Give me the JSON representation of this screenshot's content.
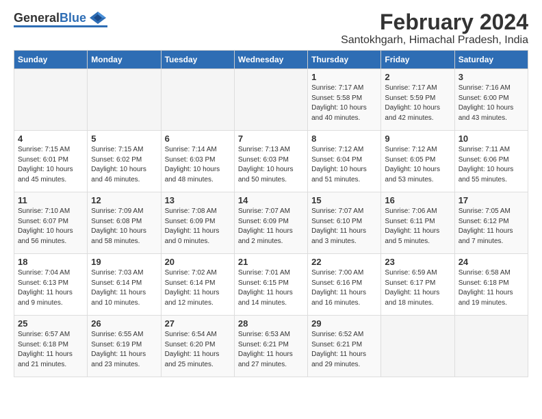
{
  "header": {
    "logo_general": "General",
    "logo_blue": "Blue",
    "title": "February 2024",
    "subtitle": "Santokhgarh, Himachal Pradesh, India"
  },
  "columns": [
    "Sunday",
    "Monday",
    "Tuesday",
    "Wednesday",
    "Thursday",
    "Friday",
    "Saturday"
  ],
  "weeks": [
    [
      {
        "day": "",
        "sunrise": "",
        "sunset": "",
        "daylight": ""
      },
      {
        "day": "",
        "sunrise": "",
        "sunset": "",
        "daylight": ""
      },
      {
        "day": "",
        "sunrise": "",
        "sunset": "",
        "daylight": ""
      },
      {
        "day": "",
        "sunrise": "",
        "sunset": "",
        "daylight": ""
      },
      {
        "day": "1",
        "sunrise": "Sunrise: 7:17 AM",
        "sunset": "Sunset: 5:58 PM",
        "daylight": "Daylight: 10 hours and 40 minutes."
      },
      {
        "day": "2",
        "sunrise": "Sunrise: 7:17 AM",
        "sunset": "Sunset: 5:59 PM",
        "daylight": "Daylight: 10 hours and 42 minutes."
      },
      {
        "day": "3",
        "sunrise": "Sunrise: 7:16 AM",
        "sunset": "Sunset: 6:00 PM",
        "daylight": "Daylight: 10 hours and 43 minutes."
      }
    ],
    [
      {
        "day": "4",
        "sunrise": "Sunrise: 7:15 AM",
        "sunset": "Sunset: 6:01 PM",
        "daylight": "Daylight: 10 hours and 45 minutes."
      },
      {
        "day": "5",
        "sunrise": "Sunrise: 7:15 AM",
        "sunset": "Sunset: 6:02 PM",
        "daylight": "Daylight: 10 hours and 46 minutes."
      },
      {
        "day": "6",
        "sunrise": "Sunrise: 7:14 AM",
        "sunset": "Sunset: 6:03 PM",
        "daylight": "Daylight: 10 hours and 48 minutes."
      },
      {
        "day": "7",
        "sunrise": "Sunrise: 7:13 AM",
        "sunset": "Sunset: 6:03 PM",
        "daylight": "Daylight: 10 hours and 50 minutes."
      },
      {
        "day": "8",
        "sunrise": "Sunrise: 7:12 AM",
        "sunset": "Sunset: 6:04 PM",
        "daylight": "Daylight: 10 hours and 51 minutes."
      },
      {
        "day": "9",
        "sunrise": "Sunrise: 7:12 AM",
        "sunset": "Sunset: 6:05 PM",
        "daylight": "Daylight: 10 hours and 53 minutes."
      },
      {
        "day": "10",
        "sunrise": "Sunrise: 7:11 AM",
        "sunset": "Sunset: 6:06 PM",
        "daylight": "Daylight: 10 hours and 55 minutes."
      }
    ],
    [
      {
        "day": "11",
        "sunrise": "Sunrise: 7:10 AM",
        "sunset": "Sunset: 6:07 PM",
        "daylight": "Daylight: 10 hours and 56 minutes."
      },
      {
        "day": "12",
        "sunrise": "Sunrise: 7:09 AM",
        "sunset": "Sunset: 6:08 PM",
        "daylight": "Daylight: 10 hours and 58 minutes."
      },
      {
        "day": "13",
        "sunrise": "Sunrise: 7:08 AM",
        "sunset": "Sunset: 6:09 PM",
        "daylight": "Daylight: 11 hours and 0 minutes."
      },
      {
        "day": "14",
        "sunrise": "Sunrise: 7:07 AM",
        "sunset": "Sunset: 6:09 PM",
        "daylight": "Daylight: 11 hours and 2 minutes."
      },
      {
        "day": "15",
        "sunrise": "Sunrise: 7:07 AM",
        "sunset": "Sunset: 6:10 PM",
        "daylight": "Daylight: 11 hours and 3 minutes."
      },
      {
        "day": "16",
        "sunrise": "Sunrise: 7:06 AM",
        "sunset": "Sunset: 6:11 PM",
        "daylight": "Daylight: 11 hours and 5 minutes."
      },
      {
        "day": "17",
        "sunrise": "Sunrise: 7:05 AM",
        "sunset": "Sunset: 6:12 PM",
        "daylight": "Daylight: 11 hours and 7 minutes."
      }
    ],
    [
      {
        "day": "18",
        "sunrise": "Sunrise: 7:04 AM",
        "sunset": "Sunset: 6:13 PM",
        "daylight": "Daylight: 11 hours and 9 minutes."
      },
      {
        "day": "19",
        "sunrise": "Sunrise: 7:03 AM",
        "sunset": "Sunset: 6:14 PM",
        "daylight": "Daylight: 11 hours and 10 minutes."
      },
      {
        "day": "20",
        "sunrise": "Sunrise: 7:02 AM",
        "sunset": "Sunset: 6:14 PM",
        "daylight": "Daylight: 11 hours and 12 minutes."
      },
      {
        "day": "21",
        "sunrise": "Sunrise: 7:01 AM",
        "sunset": "Sunset: 6:15 PM",
        "daylight": "Daylight: 11 hours and 14 minutes."
      },
      {
        "day": "22",
        "sunrise": "Sunrise: 7:00 AM",
        "sunset": "Sunset: 6:16 PM",
        "daylight": "Daylight: 11 hours and 16 minutes."
      },
      {
        "day": "23",
        "sunrise": "Sunrise: 6:59 AM",
        "sunset": "Sunset: 6:17 PM",
        "daylight": "Daylight: 11 hours and 18 minutes."
      },
      {
        "day": "24",
        "sunrise": "Sunrise: 6:58 AM",
        "sunset": "Sunset: 6:18 PM",
        "daylight": "Daylight: 11 hours and 19 minutes."
      }
    ],
    [
      {
        "day": "25",
        "sunrise": "Sunrise: 6:57 AM",
        "sunset": "Sunset: 6:18 PM",
        "daylight": "Daylight: 11 hours and 21 minutes."
      },
      {
        "day": "26",
        "sunrise": "Sunrise: 6:55 AM",
        "sunset": "Sunset: 6:19 PM",
        "daylight": "Daylight: 11 hours and 23 minutes."
      },
      {
        "day": "27",
        "sunrise": "Sunrise: 6:54 AM",
        "sunset": "Sunset: 6:20 PM",
        "daylight": "Daylight: 11 hours and 25 minutes."
      },
      {
        "day": "28",
        "sunrise": "Sunrise: 6:53 AM",
        "sunset": "Sunset: 6:21 PM",
        "daylight": "Daylight: 11 hours and 27 minutes."
      },
      {
        "day": "29",
        "sunrise": "Sunrise: 6:52 AM",
        "sunset": "Sunset: 6:21 PM",
        "daylight": "Daylight: 11 hours and 29 minutes."
      },
      {
        "day": "",
        "sunrise": "",
        "sunset": "",
        "daylight": ""
      },
      {
        "day": "",
        "sunrise": "",
        "sunset": "",
        "daylight": ""
      }
    ]
  ]
}
